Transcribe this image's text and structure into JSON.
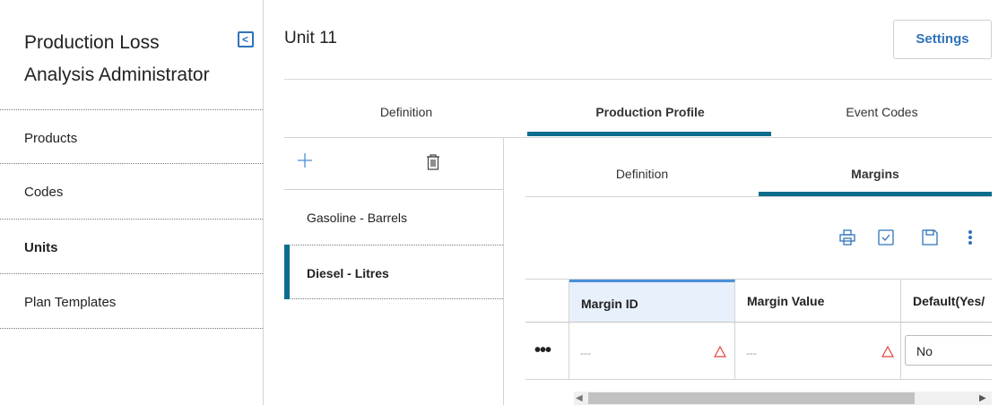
{
  "sidebar": {
    "title": "Production Loss Analysis Administrator",
    "collapse_glyph": "<",
    "items": [
      {
        "label": "Products",
        "active": false
      },
      {
        "label": "Codes",
        "active": false
      },
      {
        "label": "Units",
        "active": true
      },
      {
        "label": "Plan Templates",
        "active": false
      }
    ]
  },
  "header": {
    "unit_title": "Unit 11",
    "settings_label": "Settings"
  },
  "top_tabs": [
    {
      "label": "Definition",
      "active": false
    },
    {
      "label": "Production Profile",
      "active": true
    },
    {
      "label": "Event Codes",
      "active": false
    }
  ],
  "product_list": {
    "toolbar_icons": [
      "add-icon",
      "trash-icon"
    ],
    "items": [
      {
        "label": "Gasoline - Barrels",
        "active": false
      },
      {
        "label": "Diesel - Litres",
        "active": true
      }
    ]
  },
  "inner_tabs": [
    {
      "label": "Definition",
      "active": false
    },
    {
      "label": "Margins",
      "active": true
    }
  ],
  "grid_toolbar": [
    "print-icon",
    "checkbox-icon",
    "save-icon",
    "more-vertical-icon"
  ],
  "grid": {
    "columns": [
      "Margin ID",
      "Margin Value",
      "Default(Yes/"
    ],
    "rows": [
      {
        "row_menu": "•••",
        "margin_id": "---",
        "margin_value": "---",
        "default": "No"
      }
    ]
  },
  "colors": {
    "accent_teal": "#0d6d8c",
    "brand_blue": "#2f73b8",
    "warning_red": "#e0443a"
  }
}
